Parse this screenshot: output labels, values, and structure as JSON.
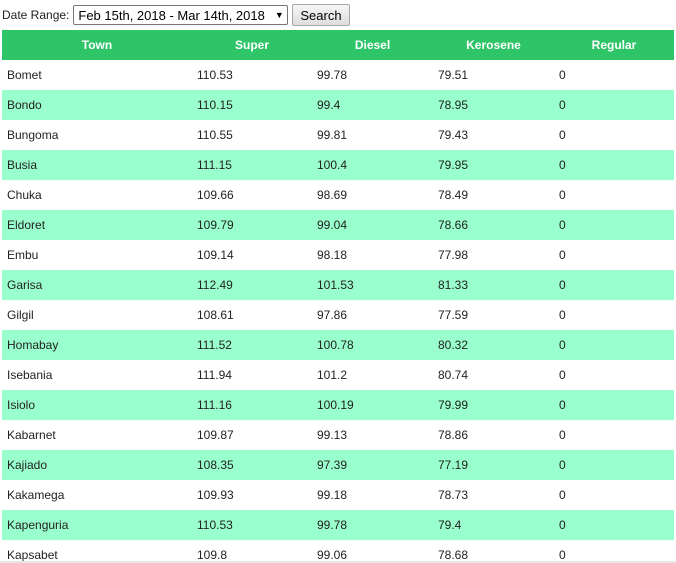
{
  "filter": {
    "label": "Date Range:",
    "selected_range": "Feb 15th, 2018 - Mar 14th, 2018",
    "search_label": "Search"
  },
  "table": {
    "headers": {
      "town": "Town",
      "super": "Super",
      "diesel": "Diesel",
      "kerosene": "Kerosene",
      "regular": "Regular"
    },
    "rows": [
      [
        "Bomet",
        "110.53",
        "99.78",
        "79.51",
        "0"
      ],
      [
        "Bondo",
        "110.15",
        "99.4",
        "78.95",
        "0"
      ],
      [
        "Bungoma",
        "110.55",
        "99.81",
        "79.43",
        "0"
      ],
      [
        "Busia",
        "111.15",
        "100.4",
        "79.95",
        "0"
      ],
      [
        "Chuka",
        "109.66",
        "98.69",
        "78.49",
        "0"
      ],
      [
        "Eldoret",
        "109.79",
        "99.04",
        "78.66",
        "0"
      ],
      [
        "Embu",
        "109.14",
        "98.18",
        "77.98",
        "0"
      ],
      [
        "Garisa",
        "112.49",
        "101.53",
        "81.33",
        "0"
      ],
      [
        "Gilgil",
        "108.61",
        "97.86",
        "77.59",
        "0"
      ],
      [
        "Homabay",
        "111.52",
        "100.78",
        "80.32",
        "0"
      ],
      [
        "Isebania",
        "111.94",
        "101.2",
        "80.74",
        "0"
      ],
      [
        "Isiolo",
        "111.16",
        "100.19",
        "79.99",
        "0"
      ],
      [
        "Kabarnet",
        "109.87",
        "99.13",
        "78.86",
        "0"
      ],
      [
        "Kajiado",
        "108.35",
        "97.39",
        "77.19",
        "0"
      ],
      [
        "Kakamega",
        "109.93",
        "99.18",
        "78.73",
        "0"
      ],
      [
        "Kapenguria",
        "110.53",
        "99.78",
        "79.4",
        "0"
      ],
      [
        "Kapsabet",
        "109.8",
        "99.06",
        "78.68",
        "0"
      ]
    ]
  },
  "colors": {
    "header_bg": "#2ec468",
    "header_text": "#ffffff",
    "stripe_bg": "#99ffcc"
  },
  "icons": {
    "dropdown": "chevron-down-icon"
  }
}
